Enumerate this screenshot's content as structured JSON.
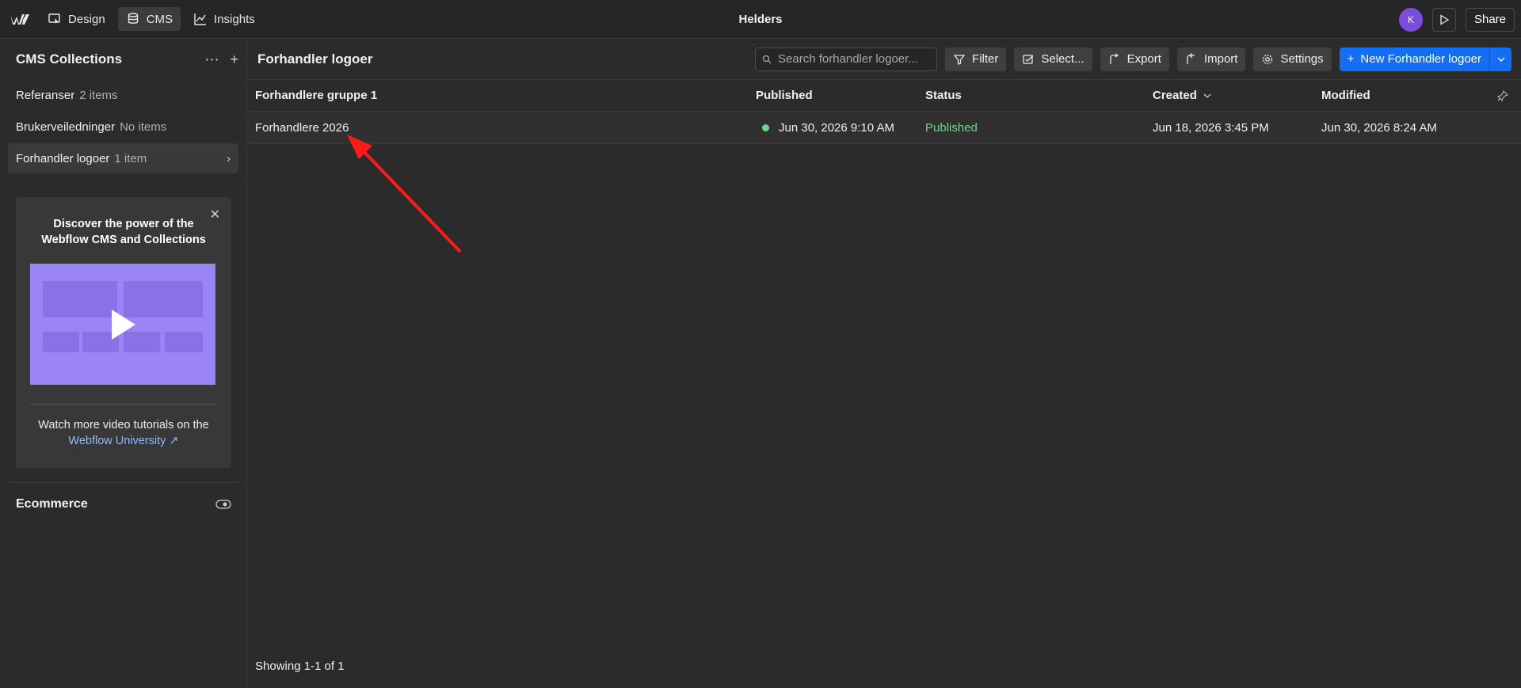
{
  "topbar": {
    "tabs": [
      {
        "label": "Design"
      },
      {
        "label": "CMS"
      },
      {
        "label": "Insights"
      }
    ],
    "site_title": "Helders",
    "avatar_initial": "K",
    "share_label": "Share"
  },
  "sidebar": {
    "title": "CMS Collections",
    "collections": [
      {
        "name": "Referanser",
        "count": "2 items"
      },
      {
        "name": "Brukerveiledninger",
        "count": "No items"
      },
      {
        "name": "Forhandler logoer",
        "count": "1 item"
      }
    ],
    "promo": {
      "title": "Discover the power of the Webflow CMS and Collections",
      "text": "Watch more video tutorials on the",
      "link": "Webflow University ↗"
    },
    "ecommerce_label": "Ecommerce"
  },
  "main": {
    "title": "Forhandler logoer",
    "search_placeholder": "Search forhandler logoer...",
    "buttons": {
      "filter": "Filter",
      "select": "Select...",
      "export": "Export",
      "import": "Import",
      "settings": "Settings",
      "new": "New Forhandler logoer"
    },
    "columns": [
      "Forhandlere gruppe 1",
      "Published",
      "Status",
      "Created",
      "Modified"
    ],
    "rows": [
      {
        "name": "Forhandlere 2026",
        "published": "Jun 30, 2026 9:10 AM",
        "status": "Published",
        "created": "Jun 18, 2026 3:45 PM",
        "modified": "Jun 30, 2026 8:24 AM"
      }
    ],
    "footer": "Showing 1-1 of 1"
  },
  "colors": {
    "accent": "#146ef5",
    "published": "#6ed58a",
    "avatar": "#7b4ddf",
    "annotation_arrow": "#ff1a1a"
  }
}
